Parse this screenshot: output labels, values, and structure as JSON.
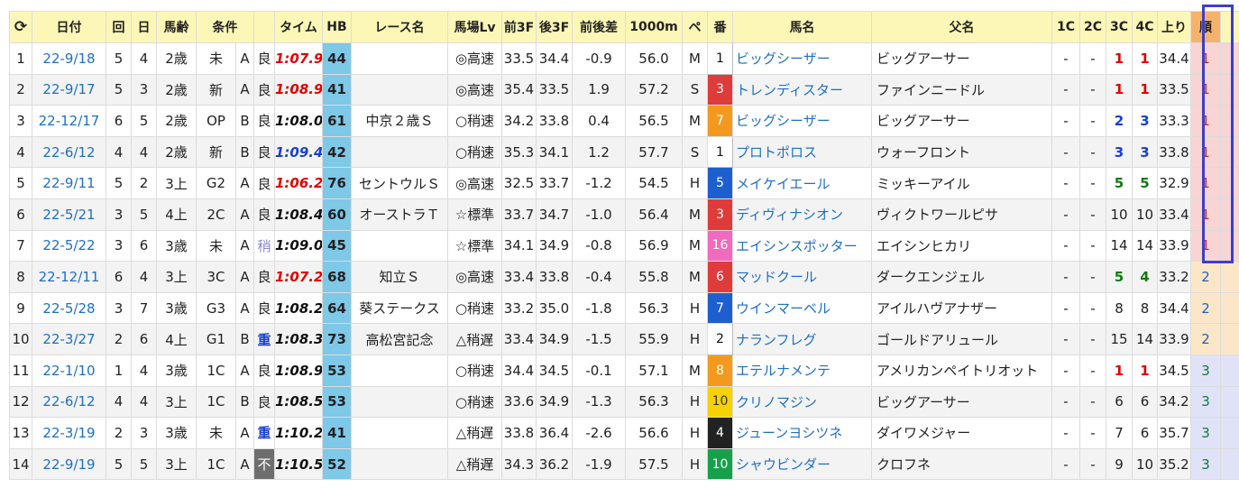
{
  "header": {
    "reload_icon": "reload-icon",
    "reload_glyph": "⟳",
    "columns": [
      "日付",
      "回",
      "日",
      "馬齢",
      "条件",
      "",
      "",
      "タイム",
      "HB",
      "レース名",
      "馬場Lv",
      "前3F",
      "後3F",
      "前後差",
      "1000m",
      "ペ",
      "番",
      "馬名",
      "父名",
      "1C",
      "2C",
      "3C",
      "4C",
      "上り",
      "順"
    ]
  },
  "rows": [
    {
      "no": "1",
      "date": "22-9/18",
      "kai": "5",
      "nichi": "4",
      "age": "2歳",
      "cond": "未",
      "grade": "A",
      "baba": "良",
      "baba_type": "ok",
      "time": "1:07.9",
      "time_color": "red",
      "hb": "44",
      "race": "",
      "lv": "◎高速",
      "f3": "33.5",
      "l3": "34.4",
      "diff": "-0.9",
      "m1000": "56.0",
      "pace": "M",
      "ban": "1",
      "gate": "g1",
      "horse": "ビッグシーザー",
      "sire": "ビッグアーサー",
      "c1": "-",
      "c2": "-",
      "c3": "1",
      "c3c": "red",
      "c4": "1",
      "c4c": "red",
      "agari": "34.4",
      "rank": "1"
    },
    {
      "no": "2",
      "date": "22-9/17",
      "kai": "5",
      "nichi": "3",
      "age": "2歳",
      "cond": "新",
      "grade": "A",
      "baba": "良",
      "baba_type": "ok",
      "time": "1:08.9",
      "time_color": "red",
      "hb": "41",
      "race": "",
      "lv": "◎高速",
      "f3": "35.4",
      "l3": "33.5",
      "diff": "1.9",
      "m1000": "57.2",
      "pace": "S",
      "ban": "3",
      "gate": "g3",
      "horse": "トレンディスター",
      "sire": "ファインニードル",
      "c1": "-",
      "c2": "-",
      "c3": "1",
      "c3c": "red",
      "c4": "1",
      "c4c": "red",
      "agari": "33.5",
      "rank": "1"
    },
    {
      "no": "3",
      "date": "22-12/17",
      "kai": "6",
      "nichi": "5",
      "age": "2歳",
      "cond": "OP",
      "grade": "B",
      "baba": "良",
      "baba_type": "ok",
      "time": "1:08.0",
      "time_color": "black",
      "hb": "61",
      "race": "中京２歳Ｓ",
      "lv": "○稍速",
      "f3": "34.2",
      "l3": "33.8",
      "diff": "0.4",
      "m1000": "56.5",
      "pace": "M",
      "ban": "7",
      "gate": "g7",
      "horse": "ビッグシーザー",
      "sire": "ビッグアーサー",
      "c1": "-",
      "c2": "-",
      "c3": "2",
      "c3c": "blue",
      "c4": "3",
      "c4c": "blue",
      "agari": "33.3",
      "rank": "1"
    },
    {
      "no": "4",
      "date": "22-6/12",
      "kai": "4",
      "nichi": "4",
      "age": "2歳",
      "cond": "新",
      "grade": "B",
      "baba": "良",
      "baba_type": "ok",
      "time": "1:09.4",
      "time_color": "blue",
      "hb": "42",
      "race": "",
      "lv": "○稍速",
      "f3": "35.3",
      "l3": "34.1",
      "diff": "1.2",
      "m1000": "57.7",
      "pace": "S",
      "ban": "1",
      "gate": "g1",
      "horse": "プロトポロス",
      "sire": "ウォーフロント",
      "c1": "-",
      "c2": "-",
      "c3": "3",
      "c3c": "blue",
      "c4": "3",
      "c4c": "blue",
      "agari": "33.8",
      "rank": "1"
    },
    {
      "no": "5",
      "date": "22-9/11",
      "kai": "5",
      "nichi": "2",
      "age": "3上",
      "cond": "G2",
      "grade": "A",
      "baba": "良",
      "baba_type": "ok",
      "time": "1:06.2",
      "time_color": "red",
      "hb": "76",
      "race": "セントウルＳ",
      "lv": "◎高速",
      "f3": "32.5",
      "l3": "33.7",
      "diff": "-1.2",
      "m1000": "54.5",
      "pace": "H",
      "ban": "5",
      "gate": "g4",
      "horse": "メイケイエール",
      "sire": "ミッキーアイル",
      "c1": "-",
      "c2": "-",
      "c3": "5",
      "c3c": "green",
      "c4": "5",
      "c4c": "green",
      "agari": "32.9",
      "rank": "1"
    },
    {
      "no": "6",
      "date": "22-5/21",
      "kai": "3",
      "nichi": "5",
      "age": "4上",
      "cond": "2C",
      "grade": "A",
      "baba": "良",
      "baba_type": "ok",
      "time": "1:08.4",
      "time_color": "black",
      "hb": "60",
      "race": "オーストラＴ",
      "lv": "☆標準",
      "f3": "33.7",
      "l3": "34.7",
      "diff": "-1.0",
      "m1000": "56.4",
      "pace": "M",
      "ban": "3",
      "gate": "g3",
      "horse": "ディヴィナシオン",
      "sire": "ヴィクトワールピサ",
      "c1": "-",
      "c2": "-",
      "c3": "10",
      "c3c": "plain",
      "c4": "10",
      "c4c": "plain",
      "agari": "33.4",
      "rank": "1"
    },
    {
      "no": "7",
      "date": "22-5/22",
      "kai": "3",
      "nichi": "6",
      "age": "3歳",
      "cond": "未",
      "grade": "A",
      "baba": "稍",
      "baba_type": "slow",
      "time": "1:09.0",
      "time_color": "black",
      "hb": "45",
      "race": "",
      "lv": "☆標準",
      "f3": "34.1",
      "l3": "34.9",
      "diff": "-0.8",
      "m1000": "56.9",
      "pace": "M",
      "ban": "16",
      "gate": "g8",
      "horse": "エイシンスポッター",
      "sire": "エイシンヒカリ",
      "c1": "-",
      "c2": "-",
      "c3": "14",
      "c3c": "plain",
      "c4": "14",
      "c4c": "plain",
      "agari": "33.9",
      "rank": "1"
    },
    {
      "no": "8",
      "date": "22-12/11",
      "kai": "6",
      "nichi": "4",
      "age": "3上",
      "cond": "3C",
      "grade": "A",
      "baba": "良",
      "baba_type": "ok",
      "time": "1:07.2",
      "time_color": "red",
      "hb": "68",
      "race": "知立Ｓ",
      "lv": "◎高速",
      "f3": "33.4",
      "l3": "33.8",
      "diff": "-0.4",
      "m1000": "55.8",
      "pace": "M",
      "ban": "6",
      "gate": "g3",
      "horse": "マッドクール",
      "sire": "ダークエンジェル",
      "c1": "-",
      "c2": "-",
      "c3": "5",
      "c3c": "green",
      "c4": "4",
      "c4c": "green",
      "agari": "33.2",
      "rank": "2"
    },
    {
      "no": "9",
      "date": "22-5/28",
      "kai": "3",
      "nichi": "7",
      "age": "3歳",
      "cond": "G3",
      "grade": "A",
      "baba": "良",
      "baba_type": "ok",
      "time": "1:08.2",
      "time_color": "black",
      "hb": "64",
      "race": "葵ステークス",
      "lv": "○稍速",
      "f3": "33.2",
      "l3": "35.0",
      "diff": "-1.8",
      "m1000": "56.3",
      "pace": "H",
      "ban": "7",
      "gate": "g4",
      "horse": "ウインマーベル",
      "sire": "アイルハヴアナザー",
      "c1": "-",
      "c2": "-",
      "c3": "8",
      "c3c": "plain",
      "c4": "8",
      "c4c": "plain",
      "agari": "34.4",
      "rank": "2"
    },
    {
      "no": "10",
      "date": "22-3/27",
      "kai": "2",
      "nichi": "6",
      "age": "4上",
      "cond": "G1",
      "grade": "B",
      "baba": "重",
      "baba_type": "bad",
      "time": "1:08.3",
      "time_color": "black",
      "hb": "73",
      "race": "高松宮記念",
      "lv": "△稍遅",
      "f3": "33.4",
      "l3": "34.9",
      "diff": "-1.5",
      "m1000": "55.9",
      "pace": "H",
      "ban": "2",
      "gate": "g1",
      "horse": "ナランフレグ",
      "sire": "ゴールドアリュール",
      "c1": "-",
      "c2": "-",
      "c3": "15",
      "c3c": "plain",
      "c4": "14",
      "c4c": "plain",
      "agari": "33.9",
      "rank": "2"
    },
    {
      "no": "11",
      "date": "22-1/10",
      "kai": "1",
      "nichi": "4",
      "age": "3歳",
      "cond": "1C",
      "grade": "A",
      "baba": "良",
      "baba_type": "ok",
      "time": "1:08.9",
      "time_color": "black",
      "hb": "53",
      "race": "",
      "lv": "○稍速",
      "f3": "34.4",
      "l3": "34.5",
      "diff": "-0.1",
      "m1000": "57.1",
      "pace": "M",
      "ban": "8",
      "gate": "g7",
      "horse": "エテルナメンテ",
      "sire": "アメリカンペイトリオット",
      "c1": "-",
      "c2": "-",
      "c3": "1",
      "c3c": "red",
      "c4": "1",
      "c4c": "red",
      "agari": "34.5",
      "rank": "3"
    },
    {
      "no": "12",
      "date": "22-6/12",
      "kai": "4",
      "nichi": "4",
      "age": "3上",
      "cond": "1C",
      "grade": "B",
      "baba": "良",
      "baba_type": "ok",
      "time": "1:08.5",
      "time_color": "black",
      "hb": "53",
      "race": "",
      "lv": "○稍速",
      "f3": "33.6",
      "l3": "34.9",
      "diff": "-1.3",
      "m1000": "56.3",
      "pace": "H",
      "ban": "10",
      "gate": "g5",
      "horse": "クリノマジン",
      "sire": "ビッグアーサー",
      "c1": "-",
      "c2": "-",
      "c3": "6",
      "c3c": "plain",
      "c4": "6",
      "c4c": "plain",
      "agari": "34.2",
      "rank": "3"
    },
    {
      "no": "13",
      "date": "22-3/19",
      "kai": "2",
      "nichi": "3",
      "age": "3歳",
      "cond": "未",
      "grade": "A",
      "baba": "重",
      "baba_type": "bad",
      "time": "1:10.2",
      "time_color": "black",
      "hb": "41",
      "race": "",
      "lv": "△稍遅",
      "f3": "33.8",
      "l3": "36.4",
      "diff": "-2.6",
      "m1000": "56.6",
      "pace": "H",
      "ban": "4",
      "gate": "g2",
      "horse": "ジューンヨシツネ",
      "sire": "ダイワメジャー",
      "c1": "-",
      "c2": "-",
      "c3": "7",
      "c3c": "plain",
      "c4": "6",
      "c4c": "plain",
      "agari": "35.7",
      "rank": "3"
    },
    {
      "no": "14",
      "date": "22-9/19",
      "kai": "5",
      "nichi": "5",
      "age": "3上",
      "cond": "1C",
      "grade": "A",
      "baba": "不",
      "baba_type": "fu",
      "time": "1:10.5",
      "time_color": "black",
      "hb": "52",
      "race": "",
      "lv": "△稍遅",
      "f3": "34.3",
      "l3": "36.2",
      "diff": "-1.9",
      "m1000": "57.5",
      "pace": "H",
      "ban": "10",
      "gate": "g6",
      "horse": "シャウビンダー",
      "sire": "クロフネ",
      "c1": "-",
      "c2": "-",
      "c3": "9",
      "c3c": "plain",
      "c4": "10",
      "c4c": "plain",
      "agari": "35.2",
      "rank": "3"
    }
  ]
}
